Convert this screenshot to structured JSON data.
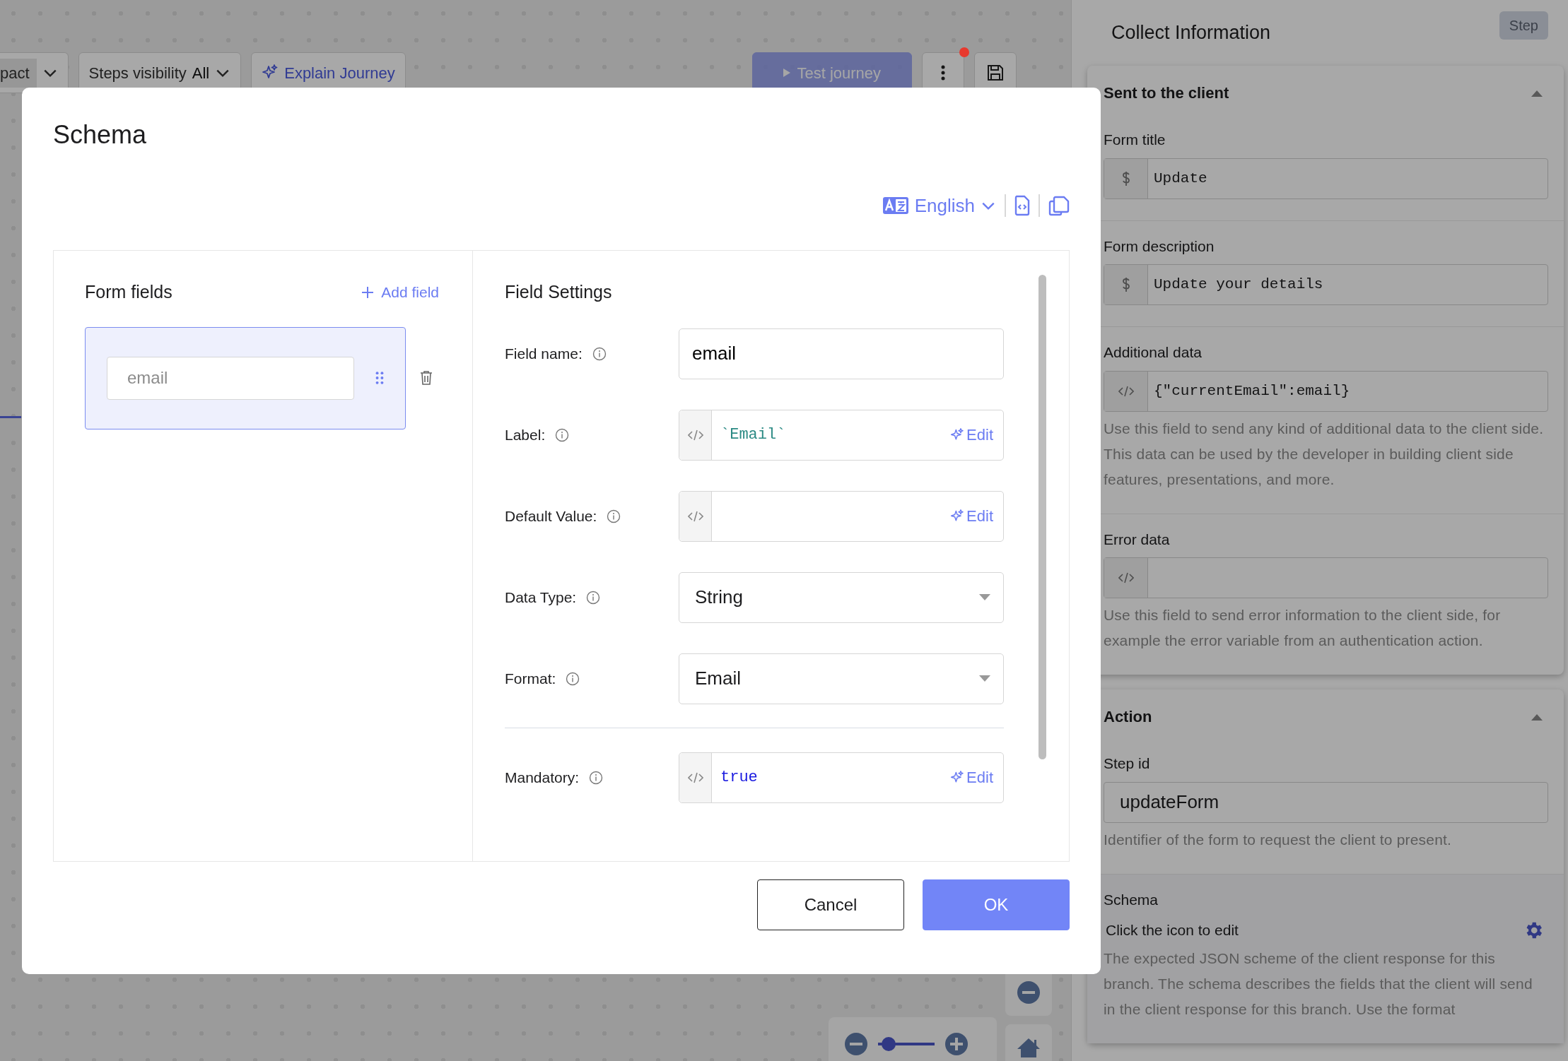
{
  "toolbar": {
    "view_select": "pact",
    "steps_visibility": {
      "label": "Steps visibility",
      "value": "All"
    },
    "explain_button": "Explain Journey",
    "test_button": {
      "label": "Test journey",
      "disabled": true
    },
    "more_button": {
      "notification": true
    }
  },
  "zoom_controls": {
    "level": 0.08
  },
  "panel": {
    "title": "Collect Information",
    "badge": "Step",
    "sections": [
      {
        "title": "Sent to the client",
        "expanded": true,
        "fields": [
          {
            "label": "Form title",
            "kind": "expression",
            "value": "Update"
          },
          {
            "label": "Form description",
            "kind": "expression",
            "value": "Update your details"
          },
          {
            "label": "Additional data",
            "kind": "code",
            "value": "{\"currentEmail\":email}",
            "help": "Use this field to send any kind of additional data to the client side. This data can be used by the developer in building client side features, presentations, and more."
          },
          {
            "label": "Error data",
            "kind": "code",
            "help": "Use this field to send error information to the client side, for example the error variable from an authentication action."
          }
        ]
      },
      {
        "title": "Action",
        "expanded": true,
        "fields": [
          {
            "label": "Step id",
            "kind": "text",
            "value": "updateForm",
            "help": "Identifier of the form to request the client to present."
          },
          {
            "label": "Schema",
            "kind": "action",
            "value": "Click the icon to edit",
            "help": "The expected JSON scheme of the client response for this branch. The schema describes the fields that the client will send in the client response for this branch. Use the format"
          }
        ]
      }
    ]
  },
  "modal": {
    "title": "Schema",
    "language": "English",
    "form_fields": {
      "title": "Form fields",
      "add_label": "Add field",
      "fields": [
        {
          "placeholder": "email",
          "selected": true
        }
      ]
    },
    "field_settings": {
      "title": "Field Settings",
      "rows": [
        {
          "label": "Field name:",
          "kind": "text",
          "value": "email"
        },
        {
          "label": "Label:",
          "kind": "code",
          "value": "`Email`",
          "color": "#2b8a84",
          "edit_label": "Edit"
        },
        {
          "label": "Default Value:",
          "kind": "code",
          "edit_label": "Edit"
        },
        {
          "label": "Data Type:",
          "kind": "select",
          "value": "String"
        },
        {
          "label": "Format:",
          "kind": "select",
          "value": "Email"
        },
        {
          "label": "Mandatory:",
          "kind": "code",
          "value": "true",
          "color": "#1a1ae0",
          "edit_label": "Edit",
          "divider_before": true
        }
      ]
    },
    "buttons": [
      {
        "label": "Cancel",
        "kind": "secondary"
      },
      {
        "label": "OK",
        "kind": "primary"
      }
    ]
  }
}
